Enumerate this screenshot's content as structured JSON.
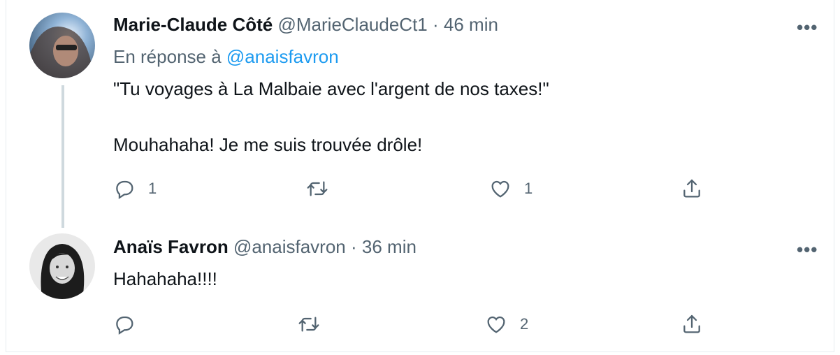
{
  "tweets": [
    {
      "name": "Marie-Claude Côté",
      "handle": "@MarieClaudeCt1",
      "time": "46 min",
      "reply_prefix": "En réponse à",
      "reply_mention": "@anaisfavron",
      "text_line1": "\"Tu voyages à La Malbaie avec l'argent de nos taxes!\"",
      "text_line2": "Mouhahaha! Je me suis trouvée drôle!",
      "replies": "1",
      "retweets": "",
      "likes": "1",
      "more": "•••"
    },
    {
      "name": "Anaïs Favron",
      "handle": "@anaisfavron",
      "time": "36 min",
      "text_line1": "Hahahaha!!!!",
      "replies": "",
      "retweets": "",
      "likes": "2",
      "more": "•••"
    }
  ],
  "separator": "·",
  "colors": {
    "accent": "#1d9bf0",
    "secondary_text": "#536471",
    "thread_line": "#cfd9de"
  }
}
